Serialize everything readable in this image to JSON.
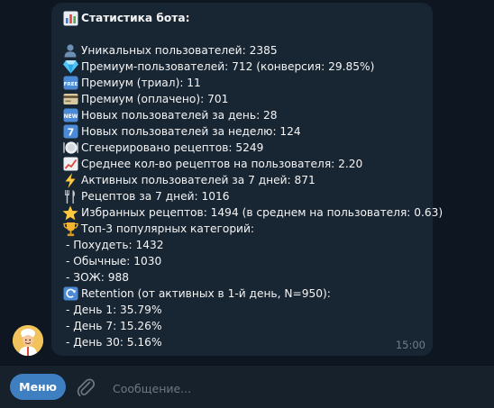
{
  "message": {
    "title": "Статистика бота:",
    "lines": [
      {
        "icon": "user-silhouette-icon",
        "text": "Уникальных пользователей: 2385"
      },
      {
        "icon": "gem-icon",
        "text": "Премиум-пользователей: 712 (конверсия: 29.85%)"
      },
      {
        "icon": "free-badge-icon",
        "text": "Премиум (триал): 11"
      },
      {
        "icon": "credit-card-icon",
        "text": "Премиум (оплачено): 701"
      },
      {
        "icon": "new-badge-icon",
        "text": "Новых пользователей за день: 28"
      },
      {
        "icon": "keycap-seven-icon",
        "text": "Новых пользователей за неделю: 124"
      },
      {
        "icon": "plate-icon",
        "text": "Сгенерировано рецептов: 5249"
      },
      {
        "icon": "chart-increasing-icon",
        "text": "Среднее кол-во рецептов на пользователя: 2.20"
      },
      {
        "icon": "lightning-icon",
        "text": "Активных пользователей за 7 дней: 871"
      },
      {
        "icon": "fork-knife-icon",
        "text": "Рецептов за 7 дней: 1016"
      },
      {
        "icon": "star-icon",
        "text": "Избранных рецептов: 1494 (в среднем на пользователя: 0.63)"
      },
      {
        "icon": "trophy-icon",
        "text": "Топ-3 популярных категорий:"
      },
      {
        "icon": "",
        "text": "- Похудеть: 1432"
      },
      {
        "icon": "",
        "text": "- Обычные: 1030"
      },
      {
        "icon": "",
        "text": "- ЗОЖ: 988"
      },
      {
        "icon": "refresh-icon",
        "text": "Retention (от активных в 1-й день, N=950):"
      },
      {
        "icon": "",
        "text": "- День 1: 35.79%"
      },
      {
        "icon": "",
        "text": "- День 7: 15.26%"
      },
      {
        "icon": "",
        "text": "- День 30: 5.16%"
      }
    ],
    "time": "15:00"
  },
  "badges": {
    "free": "FREE",
    "new": "NEW",
    "seven": "7"
  },
  "composer": {
    "menu_label": "Меню",
    "placeholder": "Сообщение..."
  },
  "colors": {
    "background": "#0e1621",
    "bubble": "#182533",
    "composer": "#17212b",
    "accent": "#3e7fc1",
    "time": "#6d7f8f"
  }
}
